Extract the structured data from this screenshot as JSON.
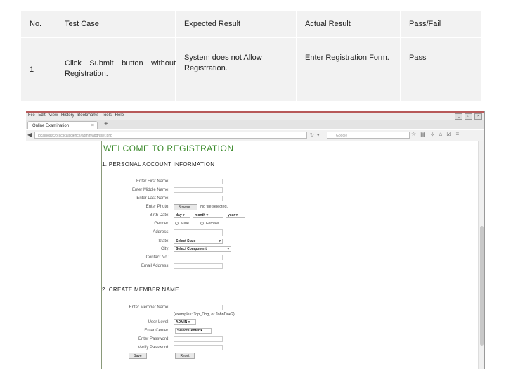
{
  "table": {
    "headers": [
      "No.",
      "Test Case",
      "Expected Result",
      "Actual Result",
      "Pass/Fail"
    ],
    "row": {
      "no": "1",
      "test_case_line1": "Click Submit button without",
      "test_case_line2": "Registration.",
      "expected_line1": "System does not Allow",
      "expected_line2": "Registration.",
      "actual": "Enter Registration Form.",
      "result": "Pass"
    }
  },
  "browser": {
    "menu": [
      "File",
      "Edit",
      "View",
      "History",
      "Bookmarks",
      "Tools",
      "Help"
    ],
    "tab_title": "Online Examination",
    "url": "localhost/c/practicalscience/admin/add/user.php",
    "search_placeholder": "Google",
    "accent_color": "#3a8a2a"
  },
  "form": {
    "title": "WELCOME TO REGISTRATION",
    "section1": "1. PERSONAL ACCOUNT INFORMATION",
    "first_name_label": "Enter First Name:",
    "middle_name_label": "Enter Middle Name:",
    "last_name_label": "Enter Last Name:",
    "photo_label": "Enter Photo:",
    "browse_button": "Browse...",
    "no_file": "No file selected.",
    "birth_date_label": "Birth Date:",
    "day_select": "day",
    "month_select": "month",
    "year_select": "year",
    "gender_label": "Gender:",
    "gender_male": "Male",
    "gender_female": "Female",
    "address_label": "Address:",
    "state_label": "State:",
    "state_select": "Select State",
    "city_label": "City:",
    "city_select": "Select Component",
    "contact_label": "Contact No.:",
    "email_label": "Email Address:",
    "section2": "2. CREATE MEMBER NAME",
    "member_name_label": "Enter Member Name:",
    "member_hint": "(examples: Top_Dog, or JohnDoe2)",
    "user_level_label": "User Level:",
    "user_level_select": "ADMIN",
    "center_label": "Enter Center:",
    "center_select": "Select Center",
    "password_label": "Enter Password:",
    "verify_password_label": "Verify Password:",
    "save_button": "Save",
    "reset_button": "Reset"
  }
}
